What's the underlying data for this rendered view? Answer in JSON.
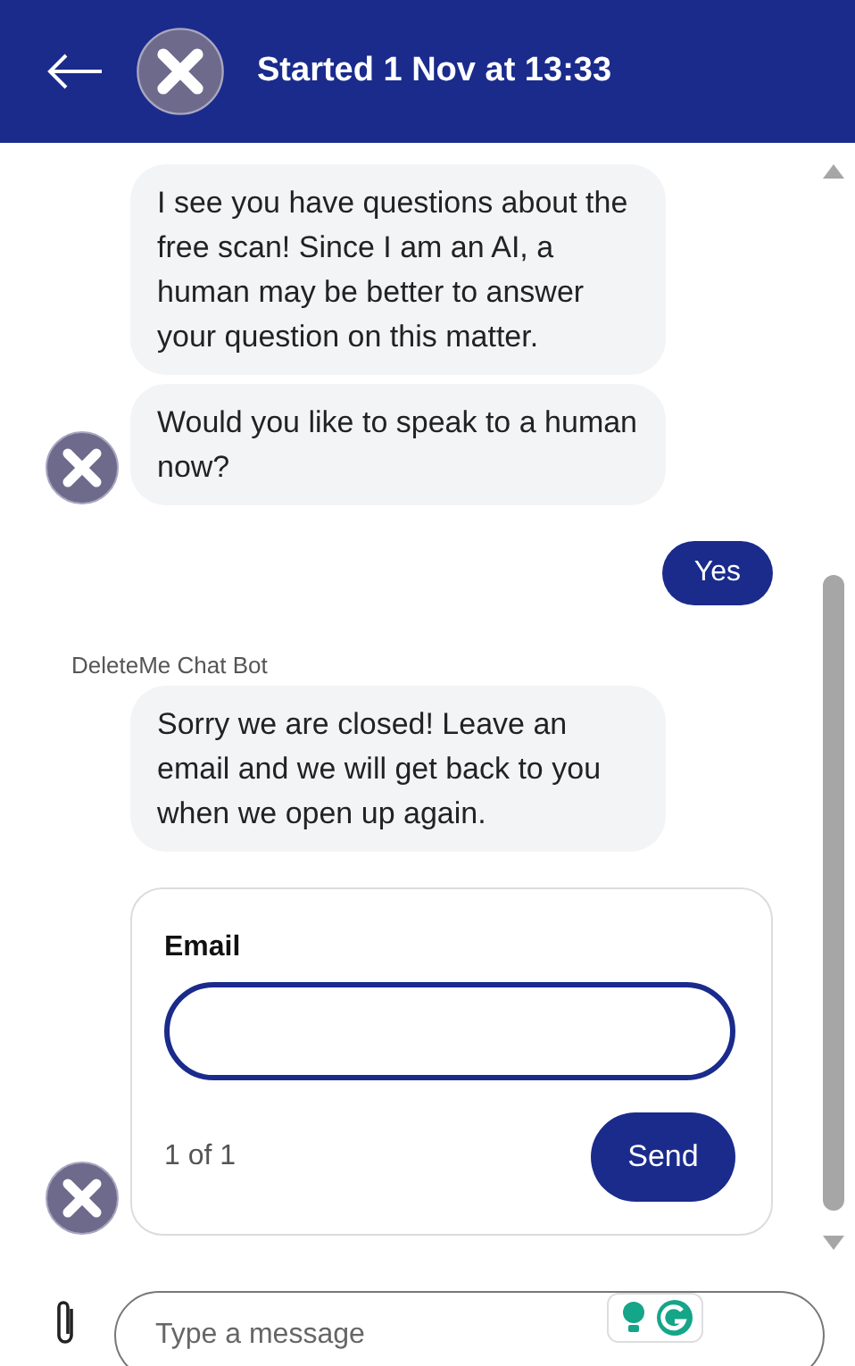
{
  "header": {
    "title": "Started 1 Nov at 13:33"
  },
  "messages": [
    {
      "kind": "bot",
      "texts": [
        "I see you have questions about the free scan! Since I am an AI, a human may be better to answer your question on this matter.",
        "Would you like to speak to a human now?"
      ]
    },
    {
      "kind": "user",
      "texts": [
        "Yes"
      ]
    },
    {
      "kind": "bot",
      "sender": "DeleteMe Chat Bot",
      "texts": [
        "Sorry we are closed! Leave an email and we will get back to you when we open up again."
      ]
    }
  ],
  "form": {
    "field_label": "Email",
    "counter": "1 of 1",
    "button": "Send"
  },
  "composer": {
    "placeholder": "Type a message"
  }
}
